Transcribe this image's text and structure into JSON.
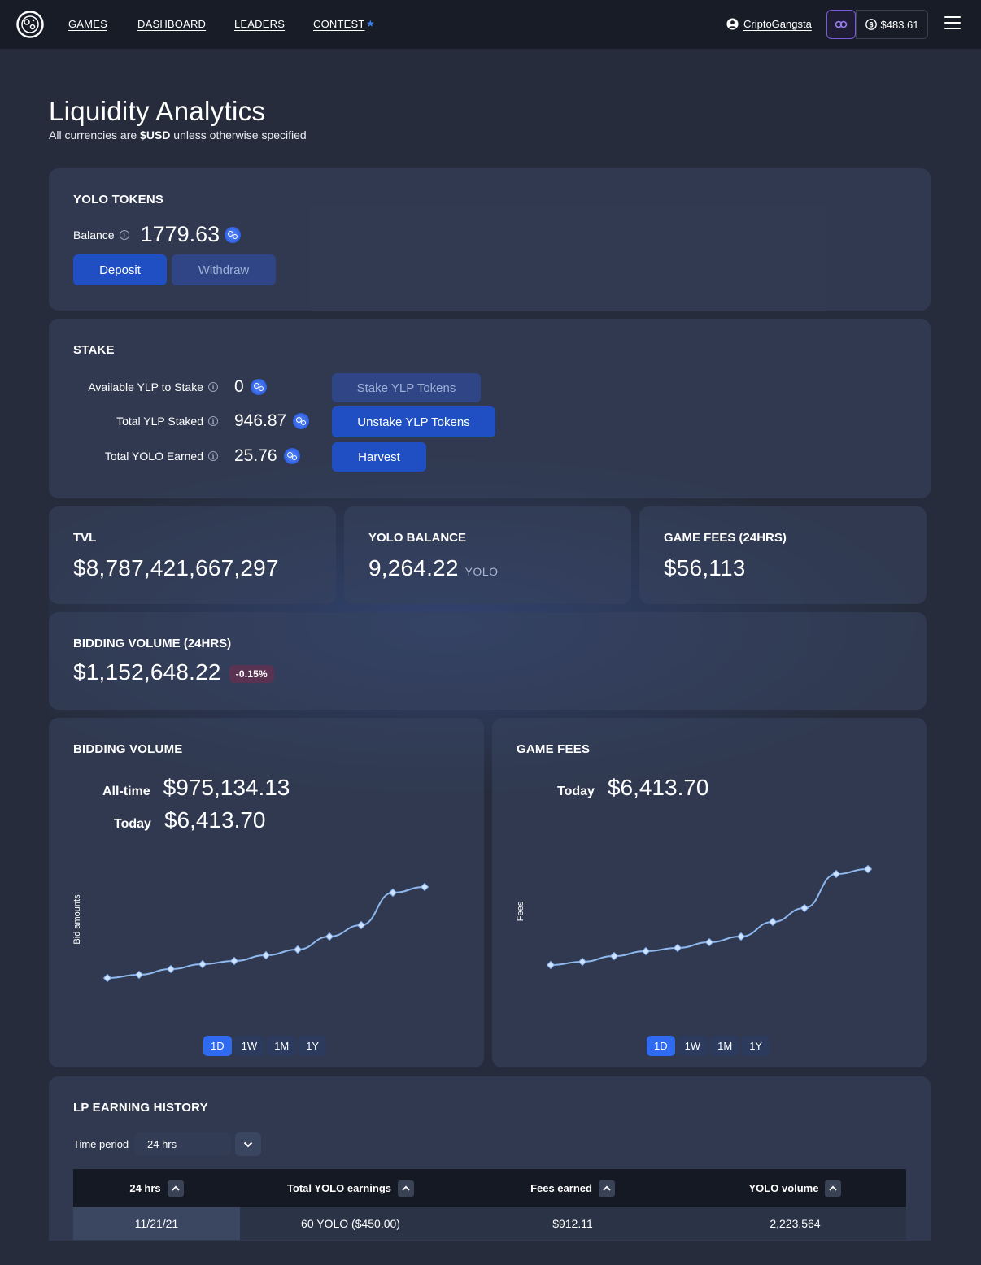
{
  "nav": {
    "links": [
      "GAMES",
      "DASHBOARD",
      "LEADERS",
      "CONTEST"
    ],
    "contest_icon": "star-icon",
    "username": "CriptoGangsta",
    "balance": "$483.61",
    "icons": [
      "logo-icon",
      "user-icon",
      "link-icon",
      "dollar-coin-icon",
      "hamburger-menu-icon"
    ]
  },
  "header": {
    "title": "Liquidity Analytics",
    "subtitle_prefix": "All currencies are ",
    "subtitle_bold": "$USD",
    "subtitle_suffix": " unless otherwise specified"
  },
  "yolo_tokens": {
    "title": "YOLO TOKENS",
    "balance_label": "Balance",
    "balance_value": "1779.63",
    "deposit_label": "Deposit",
    "withdraw_label": "Withdraw"
  },
  "stake": {
    "title": "STAKE",
    "rows": [
      {
        "label": "Available YLP to Stake",
        "value": "0",
        "action": "Stake YLP Tokens"
      },
      {
        "label": "Total YLP Staked",
        "value": "946.87",
        "action": "Unstake YLP Tokens"
      },
      {
        "label": "Total YOLO Earned",
        "value": "25.76",
        "action": "Harvest"
      }
    ]
  },
  "stats": {
    "tvl": {
      "title": "TVL",
      "value": "$8,787,421,667,297"
    },
    "yolo_balance": {
      "title": "YOLO BALANCE",
      "value": "9,264.22",
      "unit": "YOLO"
    },
    "game_fees": {
      "title": "GAME FEES (24HRS)",
      "value": "$56,113"
    },
    "bidding_volume": {
      "title": "BIDDING VOLUME (24HRS)",
      "value": "$1,152,648.22",
      "change": "-0.15%"
    }
  },
  "bidding_chart": {
    "title": "BIDDING VOLUME",
    "alltime_label": "All-time",
    "alltime_value": "$975,134.13",
    "today_label": "Today",
    "today_value": "$6,413.70",
    "ylabel": "Bid amounts",
    "ranges": [
      "1D",
      "1W",
      "1M",
      "1Y"
    ],
    "active_range": "1D"
  },
  "fees_chart": {
    "title": "GAME FEES",
    "today_label": "Today",
    "today_value": "$6,413.70",
    "ylabel": "Fees",
    "ranges": [
      "1D",
      "1W",
      "1M",
      "1Y"
    ],
    "active_range": "1D"
  },
  "chart_data": [
    {
      "type": "line",
      "title": "BIDDING VOLUME",
      "xlabel": "",
      "ylabel": "Bid amounts",
      "series": [
        {
          "values": [
            10,
            14,
            21,
            27,
            31,
            38,
            45,
            61,
            75,
            115,
            122
          ]
        }
      ],
      "ylim": [
        0,
        140
      ],
      "grid": false,
      "color": "#8fb8ee"
    },
    {
      "type": "line",
      "title": "GAME FEES",
      "xlabel": "",
      "ylabel": "Fees",
      "series": [
        {
          "values": [
            10,
            14,
            21,
            27,
            31,
            38,
            45,
            63,
            80,
            122,
            128
          ]
        }
      ],
      "ylim": [
        0,
        140
      ],
      "grid": false,
      "color": "#8fb8ee"
    }
  ],
  "lp_history": {
    "title": "LP EARNING HISTORY",
    "time_period_label": "Time period",
    "time_period_value": "24 hrs",
    "columns": [
      "24 hrs",
      "Total YOLO earnings",
      "Fees earned",
      "YOLO volume"
    ],
    "rows": [
      [
        "11/21/21",
        "60 YOLO ($450.00)",
        "$912.11",
        "2,223,564"
      ]
    ]
  },
  "colors": {
    "primary": "#1f4fc2",
    "accent_blue": "#2f6bf0",
    "negative_badge": "#5b3352",
    "link_border": "#7c5cd6"
  }
}
